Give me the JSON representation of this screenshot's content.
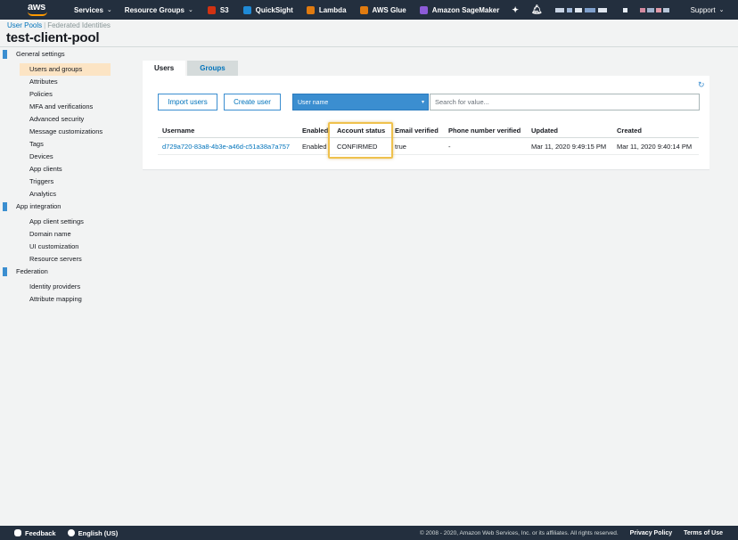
{
  "topnav": {
    "services": "Services",
    "resource_groups": "Resource Groups",
    "s3": "S3",
    "quicksight": "QuickSight",
    "lambda": "Lambda",
    "glue": "AWS Glue",
    "sagemaker": "Amazon SageMaker",
    "support": "Support",
    "logo_text": "aws"
  },
  "breadcrumb": {
    "user_pools": "User Pools",
    "separator": "|",
    "federated_identities": "Federated Identities"
  },
  "pool_title": "test-client-pool",
  "sidebar": {
    "general_settings": "General settings",
    "general_items": [
      "Users and groups",
      "Attributes",
      "Policies",
      "MFA and verifications",
      "Advanced security",
      "Message customizations",
      "Tags",
      "Devices",
      "App clients",
      "Triggers",
      "Analytics"
    ],
    "app_integration": "App integration",
    "app_items": [
      "App client settings",
      "Domain name",
      "UI customization",
      "Resource servers"
    ],
    "federation": "Federation",
    "federation_items": [
      "Identity providers",
      "Attribute mapping"
    ]
  },
  "tabs": {
    "users": "Users",
    "groups": "Groups"
  },
  "toolbar": {
    "import_users": "Import users",
    "create_user": "Create user",
    "filter_select": "User name",
    "search_placeholder": "Search for value..."
  },
  "table": {
    "headers": [
      "Username",
      "Enabled",
      "Account status",
      "Email verified",
      "Phone number verified",
      "Updated",
      "Created"
    ],
    "rows": [
      [
        "d729a720-83a8-4b3e-a46d-c51a38a7a757",
        "Enabled",
        "CONFIRMED",
        "true",
        "-",
        "Mar 11, 2020 9:49:15 PM",
        "Mar 11, 2020 9:40:14 PM"
      ]
    ]
  },
  "footer": {
    "feedback": "Feedback",
    "language": "English (US)",
    "copyright": "© 2008 - 2020, Amazon Web Services, Inc. or its affiliates. All rights reserved.",
    "privacy": "Privacy Policy",
    "terms": "Terms of Use"
  },
  "colors": {
    "nav_bg": "#232f3e",
    "accent_blue": "#3b8ed0",
    "link_blue": "#0073bb",
    "active_item_bg": "#fce4c4",
    "highlight": "#efc14d",
    "aws_orange": "#ff9900"
  }
}
